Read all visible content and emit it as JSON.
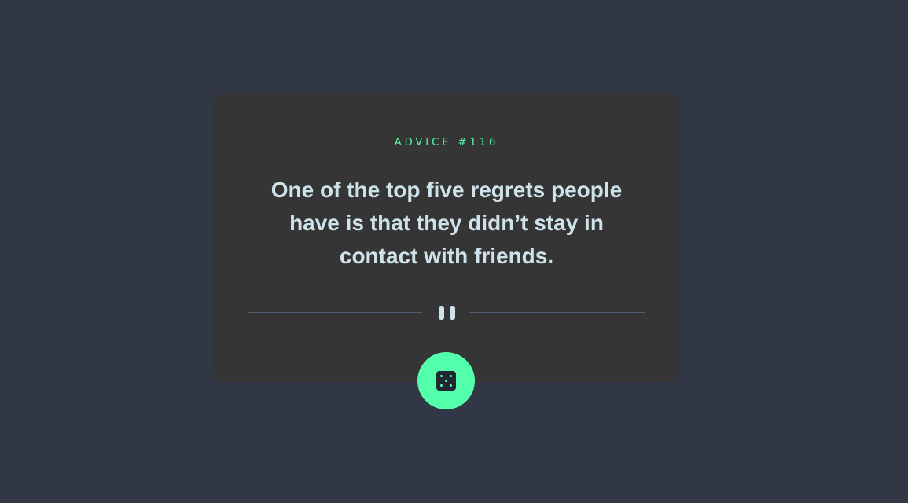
{
  "card": {
    "advice_label": "ADVICE #116",
    "advice_text": "One of the top five regrets people have is that they didn’t stay in contact with friends."
  },
  "divider": {
    "icon": "pause-icon"
  },
  "dice_button": {
    "icon": "dice-icon"
  },
  "colors": {
    "background": "#313745",
    "card": "#353535",
    "accent": "#53ffaa",
    "text": "#cee3e9",
    "divider": "#4f5d74",
    "dice_face": "#202733"
  }
}
